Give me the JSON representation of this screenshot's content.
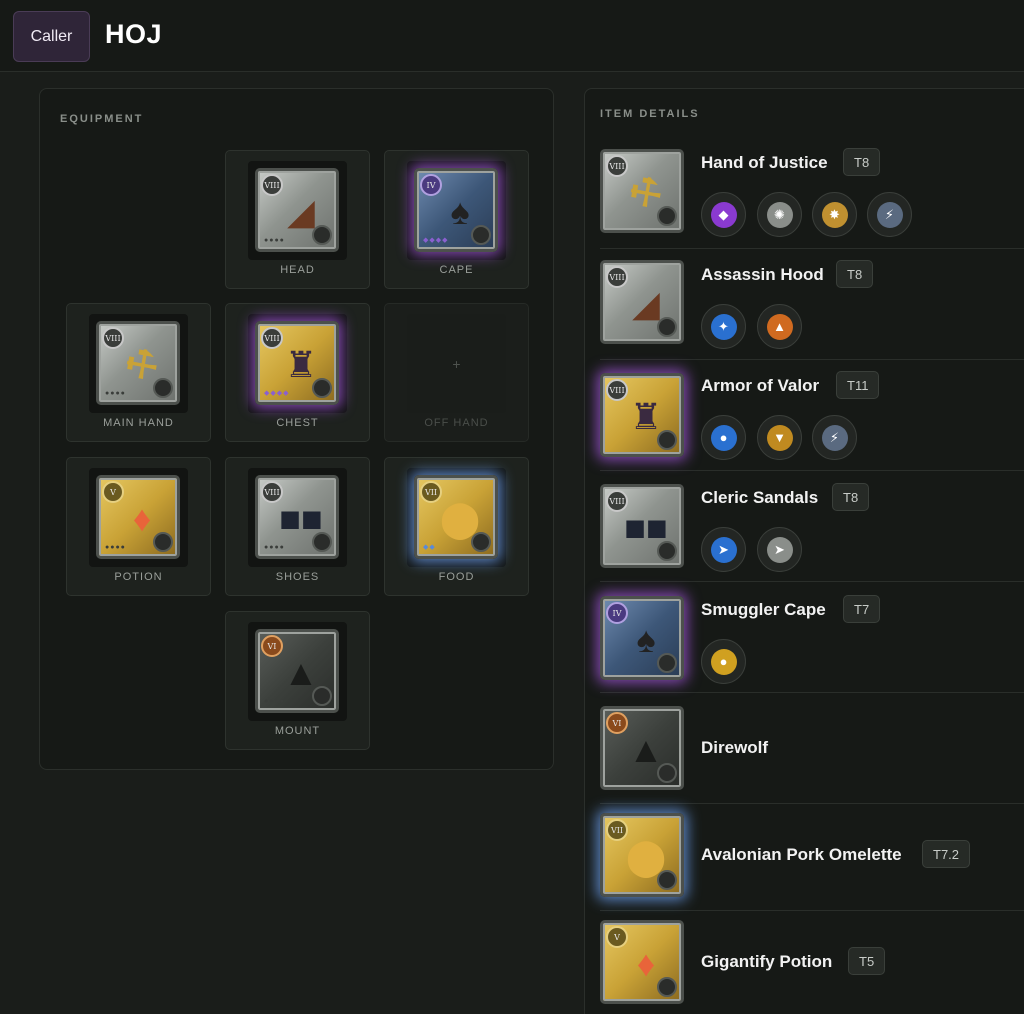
{
  "header": {
    "role": "Caller",
    "title": "HOJ"
  },
  "equipment": {
    "title": "EQUIPMENT",
    "slots": [
      {
        "label": "HEAD",
        "tier": "VIII"
      },
      {
        "label": "CAPE",
        "tier": "IV"
      },
      {
        "label": "MAIN HAND",
        "tier": "VIII"
      },
      {
        "label": "CHEST",
        "tier": "VIII"
      },
      {
        "label": "OFF HAND",
        "placeholder": "+"
      },
      {
        "label": "POTION",
        "tier": "V"
      },
      {
        "label": "SHOES",
        "tier": "VIII"
      },
      {
        "label": "FOOD",
        "tier": "VII"
      },
      {
        "label": "MOUNT",
        "tier": "VI"
      }
    ]
  },
  "details": {
    "title": "ITEM DETAILS",
    "items": [
      {
        "name": "Hand of Justice",
        "tier": "T8",
        "tier_badge": "VIII",
        "spells": [
          "purple-shield-icon",
          "silver-spin-icon",
          "gold-burst-icon",
          "lightning-icon"
        ]
      },
      {
        "name": "Assassin Hood",
        "tier": "T8",
        "tier_badge": "VIII",
        "spells": [
          "blue-slash-icon",
          "fire-icon"
        ]
      },
      {
        "name": "Armor of Valor",
        "tier": "T11",
        "tier_badge": "VIII",
        "spells": [
          "blue-drop-icon",
          "gold-crest-icon",
          "lightning-icon"
        ]
      },
      {
        "name": "Cleric Sandals",
        "tier": "T8",
        "tier_badge": "VIII",
        "spells": [
          "blue-dash-icon",
          "silver-dash-icon"
        ]
      },
      {
        "name": "Smuggler Cape",
        "tier": "T7",
        "tier_badge": "IV",
        "spells": [
          "gold-flame-icon"
        ]
      },
      {
        "name": "Direwolf",
        "tier": "",
        "tier_badge": "VI",
        "spells": []
      },
      {
        "name": "Avalonian Pork Omelette",
        "tier": "T7.2",
        "tier_badge": "VII",
        "spells": []
      },
      {
        "name": "Gigantify Potion",
        "tier": "T5",
        "tier_badge": "V",
        "spells": []
      }
    ]
  },
  "colors": {
    "background": "#1a1d1a",
    "panel": "#161916",
    "role_badge": "#2f2538",
    "purple_glow": "#aa5ae6",
    "blue_glow": "#6ea0f0"
  }
}
